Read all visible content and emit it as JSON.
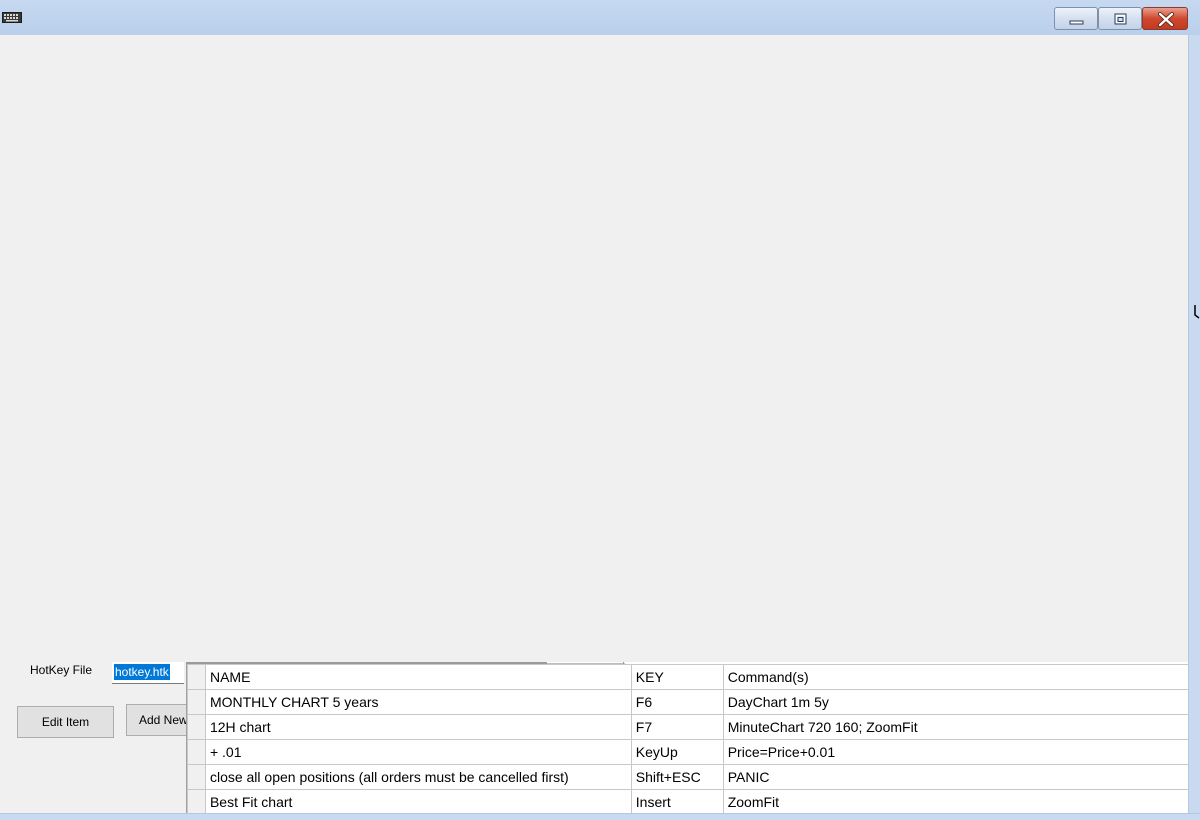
{
  "window": {
    "icons": {
      "app": "keyboard-icon",
      "minimize": "minimize-icon",
      "maximize": "maximize-icon",
      "close": "close-icon"
    }
  },
  "form": {
    "hotkey_file_label": "HotKey File",
    "hotkey_file_value": "hotkey.htk",
    "edit_item_label": "Edit Item",
    "add_new_label": "Add New"
  },
  "grid": {
    "columns": [
      "NAME",
      "KEY",
      "Command(s)"
    ],
    "rows": [
      {
        "name": "MONTHLY CHART 5 years",
        "key": "F6",
        "command": "DayChart 1m 5y"
      },
      {
        "name": "12H chart",
        "key": "F7",
        "command": "MinuteChart 720 160; ZoomFit"
      },
      {
        "name": "+ .01",
        "key": "KeyUp",
        "command": "Price=Price+0.01"
      },
      {
        "name": "close all open positions (all orders must be cancelled first)",
        "key": "Shift+ESC",
        "command": "PANIC"
      },
      {
        "name": "Best Fit chart",
        "key": "Insert",
        "command": "ZoomFit"
      }
    ]
  },
  "colors": {
    "title_bar": "#c6d9f1",
    "client_bg": "#f0f0f0",
    "selection": "#0078d7",
    "close_button": "#d0482f"
  }
}
